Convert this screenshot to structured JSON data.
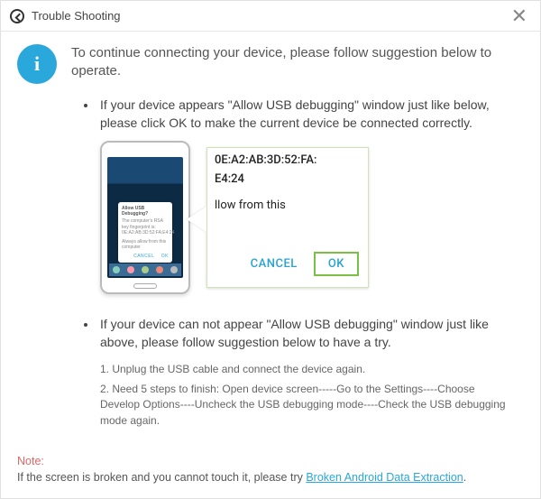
{
  "header": {
    "title": "Trouble Shooting",
    "close": "✕"
  },
  "info_glyph": "i",
  "intro": "To continue connecting your device, please follow suggestion below to operate.",
  "bullet1": "If your device appears \"Allow USB debugging\" window just like below, please click OK to make the current device  be connected correctly.",
  "phone_dialog": {
    "title": "Allow USB Debugging?",
    "body": "The computer's RSA key fingerprint is: 0E:A2:AB:3D:52:FA:E4:24",
    "check": "Always allow from this computer",
    "cancel": "CANCEL",
    "ok": "OK"
  },
  "zoom": {
    "mac": "0E:A2:AB:3D:52:FA:",
    "mac2": "E4:24",
    "allow": "llow from this",
    "allow2": "",
    "cancel": "CANCEL",
    "ok": "OK"
  },
  "bullet2": "If your device can not appear \"Allow USB debugging\" window just like above, please follow suggestion below to have a try.",
  "steps": {
    "s1": "1. Unplug the USB cable and connect the device again.",
    "s2": "2. Need 5 steps to finish: Open device screen-----Go to the Settings----Choose Develop Options----Uncheck the USB debugging mode----Check the USB debugging mode again."
  },
  "footer": {
    "note": "Note:",
    "text_a": "If the screen is broken and you cannot touch it, please try ",
    "link": "Broken Android Data Extraction",
    "text_b": "."
  }
}
